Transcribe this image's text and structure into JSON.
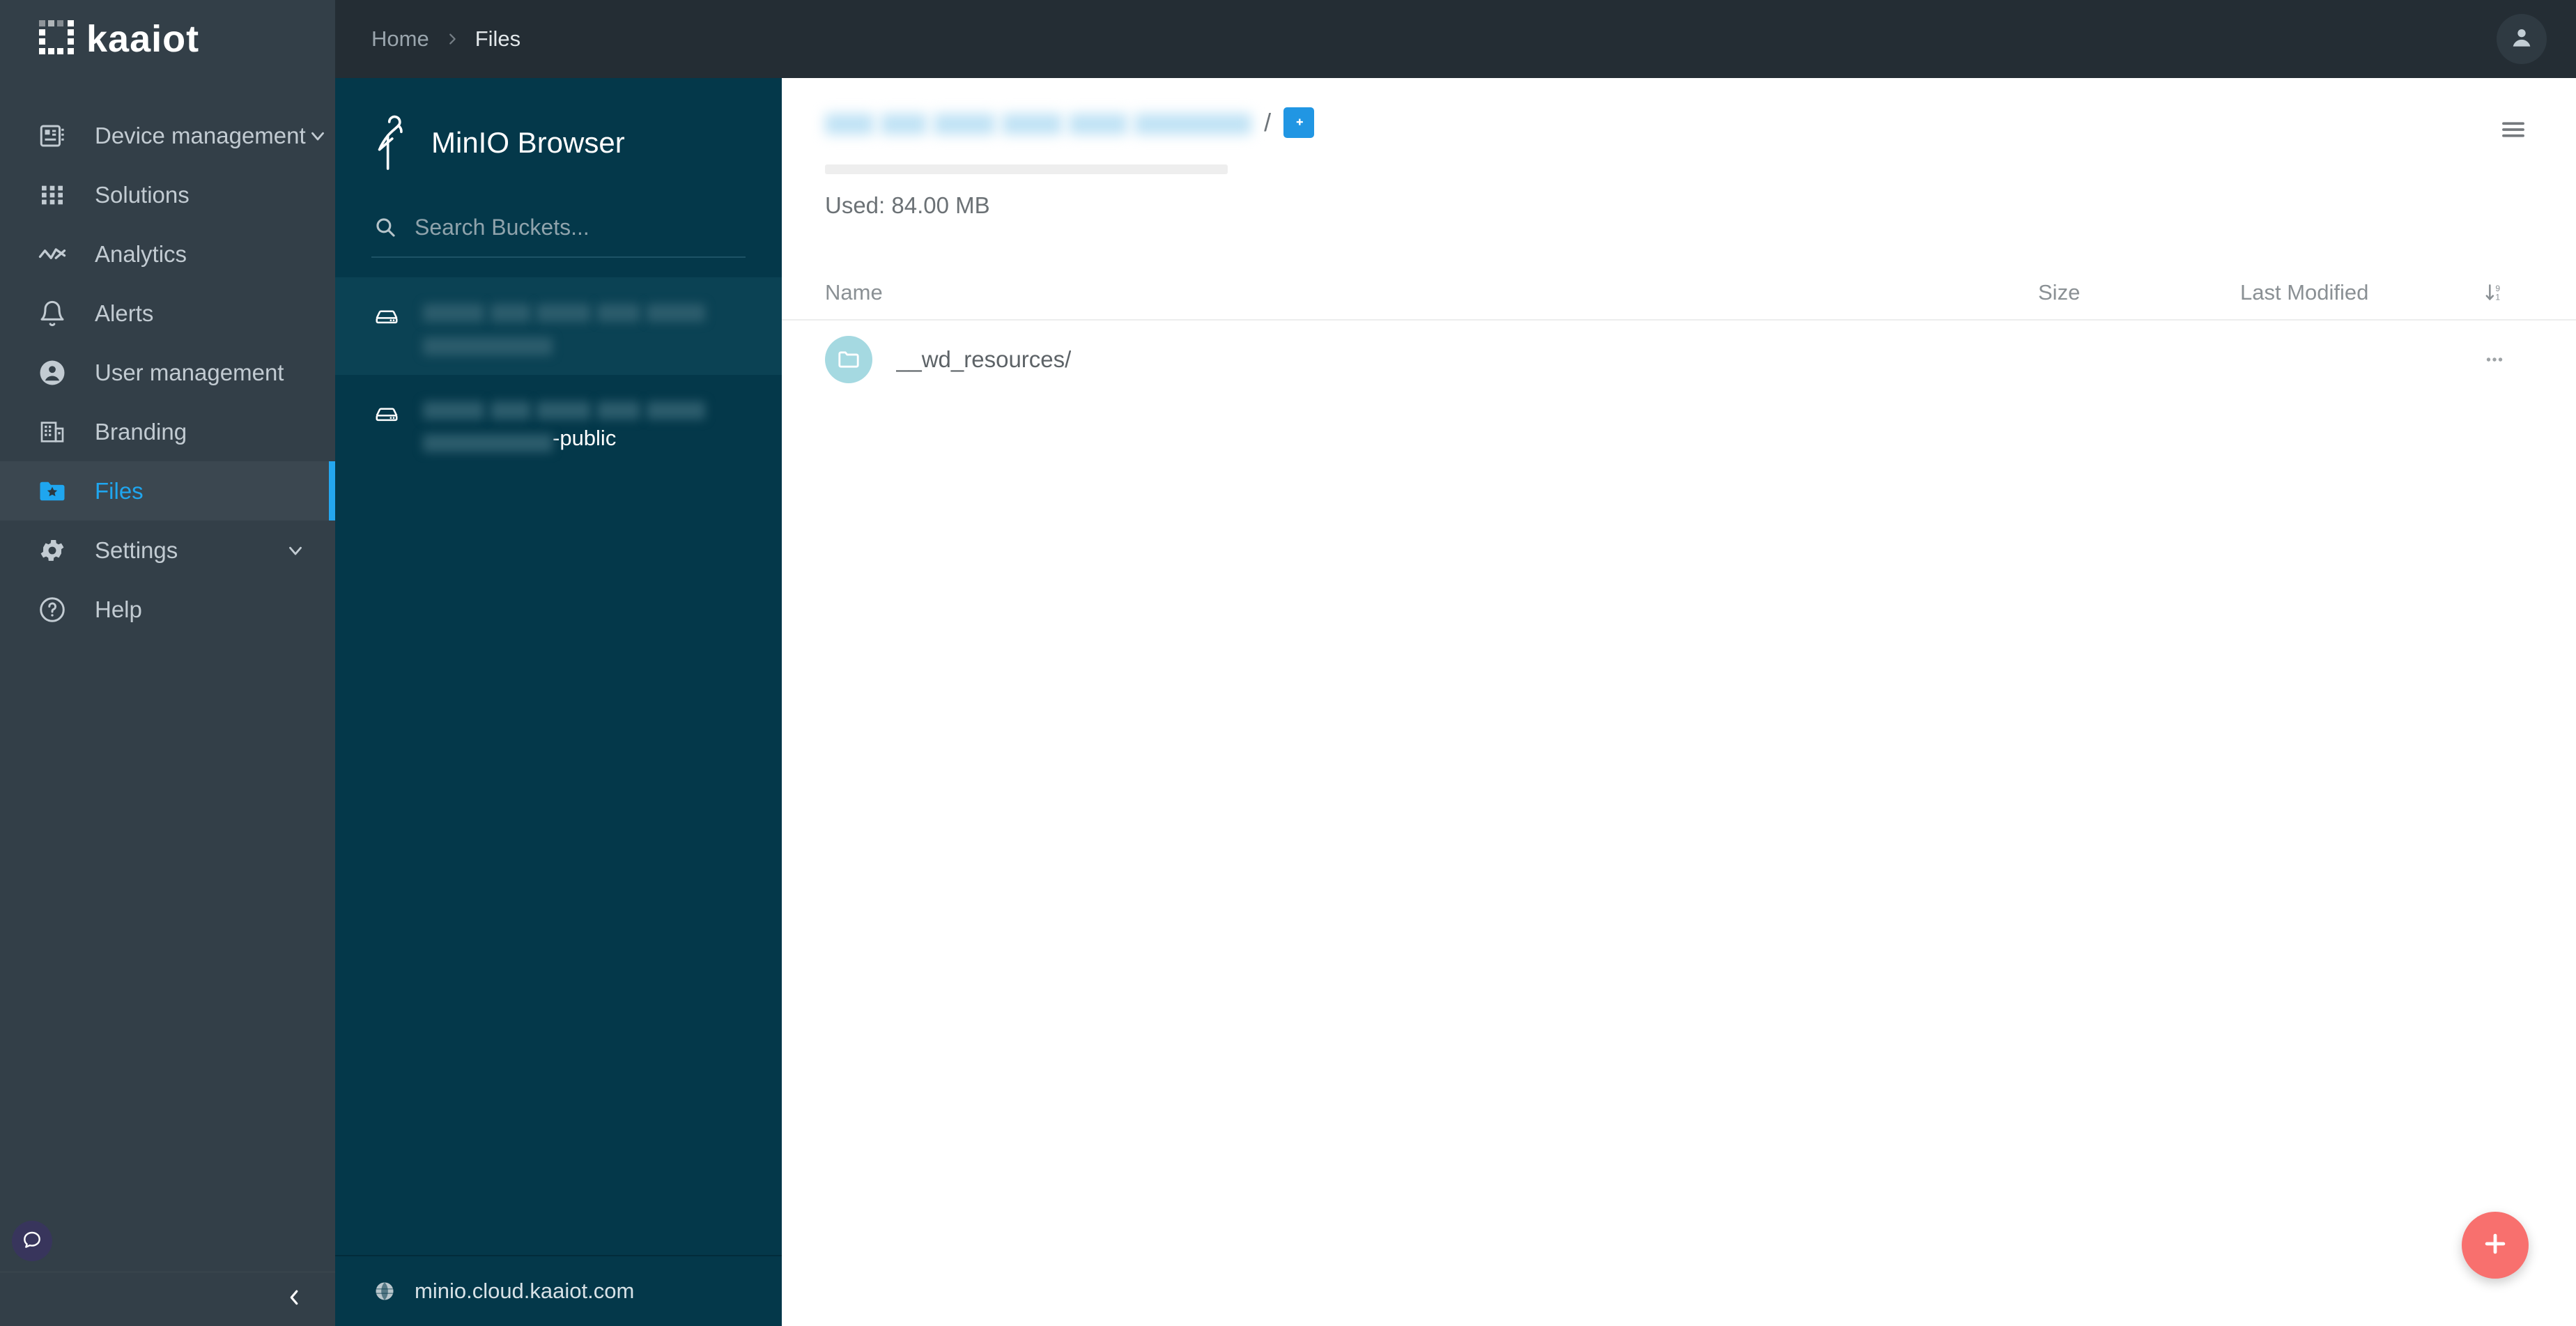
{
  "brand": {
    "logo_text": "kaaiot",
    "logo_icon": "kaaiot-bracket-logo"
  },
  "topbar": {
    "breadcrumb": [
      {
        "label": "Home",
        "current": false
      },
      {
        "label": "Files",
        "current": true
      }
    ],
    "separator_icon": "chevron-right-icon",
    "avatar_icon": "user-avatar-icon"
  },
  "sidebar": {
    "items": [
      {
        "label": "Device management",
        "icon": "device-management-icon",
        "expandable": true,
        "active": false
      },
      {
        "label": "Solutions",
        "icon": "solutions-grid-icon",
        "expandable": false,
        "active": false
      },
      {
        "label": "Analytics",
        "icon": "analytics-chart-icon",
        "expandable": false,
        "active": false
      },
      {
        "label": "Alerts",
        "icon": "bell-icon",
        "expandable": false,
        "active": false
      },
      {
        "label": "User management",
        "icon": "user-circle-icon",
        "expandable": false,
        "active": false
      },
      {
        "label": "Branding",
        "icon": "building-icon",
        "expandable": false,
        "active": false
      },
      {
        "label": "Files",
        "icon": "folder-star-icon",
        "expandable": false,
        "active": true
      },
      {
        "label": "Settings",
        "icon": "gear-icon",
        "expandable": true,
        "active": false
      },
      {
        "label": "Help",
        "icon": "help-circle-icon",
        "expandable": false,
        "active": false
      }
    ],
    "chat_icon": "chat-bubble-icon",
    "collapse_icon": "chevron-left-icon"
  },
  "minio": {
    "title": "MinIO Browser",
    "logo_icon": "minio-heron-icon",
    "search": {
      "placeholder": "Search Buckets...",
      "value": "",
      "icon": "search-icon"
    },
    "buckets": [
      {
        "icon": "bucket-drive-icon",
        "redacted": true,
        "redacted_segments": [
          88,
          58,
          78,
          62,
          84,
          186
        ],
        "suffix": "",
        "selected": true
      },
      {
        "icon": "bucket-drive-icon",
        "redacted": true,
        "redacted_segments": [
          88,
          58,
          78,
          62,
          84,
          186
        ],
        "suffix": "-public",
        "selected": false
      }
    ],
    "footer": {
      "url": "minio.cloud.kaaiot.com",
      "icon": "globe-icon"
    }
  },
  "main": {
    "path": {
      "bucket_redacted": true,
      "bucket_redacted_segments": [
        70,
        66,
        88,
        86,
        84,
        168
      ],
      "separator": "/",
      "new_folder_icon": "folder-plus-icon"
    },
    "usage": {
      "label": "Used: 84.00 MB",
      "bar_percent": 8
    },
    "menu_icon": "hamburger-menu-icon",
    "table": {
      "columns": [
        {
          "key": "name",
          "label": "Name"
        },
        {
          "key": "size",
          "label": "Size"
        },
        {
          "key": "modified",
          "label": "Last Modified"
        }
      ],
      "sort_icon": "sort-descending-9-1-icon",
      "rows": [
        {
          "icon": "folder-icon",
          "name": "__wd_resources/",
          "size": "",
          "modified": "",
          "actions_icon": "more-horizontal-icon"
        }
      ]
    },
    "fab": {
      "icon": "plus-icon"
    }
  },
  "colors": {
    "sidebar_bg": "#333f48",
    "topbar_bg": "#242d34",
    "accent_blue": "#24a7ef",
    "minio_panel_bg": "#04384a",
    "minio_selected_bg": "#0b4254",
    "new_folder_blue": "#2196e3",
    "folder_avatar_teal": "#a5d9e1",
    "fab_coral": "#f8706e",
    "chat_purple": "#38355c"
  }
}
